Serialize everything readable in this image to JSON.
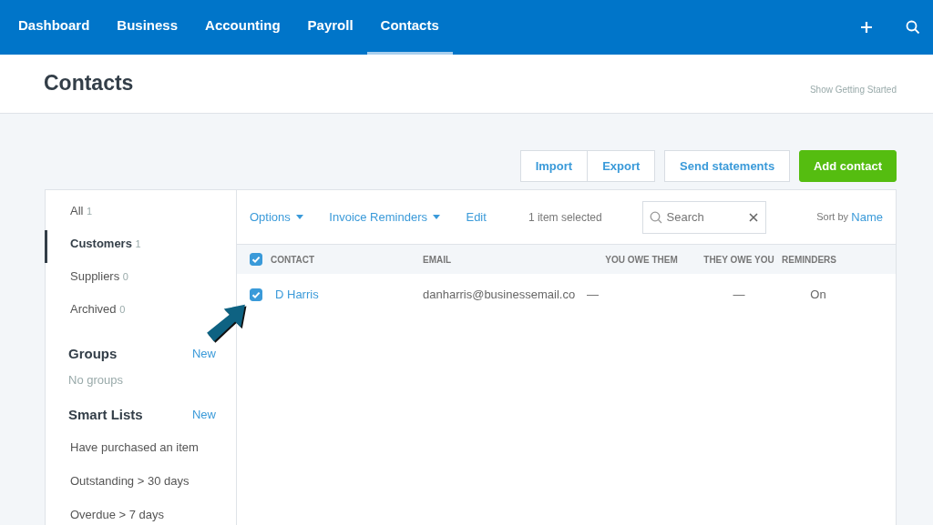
{
  "nav": {
    "tabs": [
      {
        "label": "Dashboard",
        "selected": false
      },
      {
        "label": "Business",
        "selected": false
      },
      {
        "label": "Accounting",
        "selected": false
      },
      {
        "label": "Payroll",
        "selected": false
      },
      {
        "label": "Contacts",
        "selected": true
      }
    ]
  },
  "header": {
    "title": "Contacts",
    "link": "Show Getting Started"
  },
  "actions": {
    "group": [
      "Import",
      "Export"
    ],
    "secondary": "Send statements",
    "primary": "Add contact"
  },
  "sidebar": {
    "items": [
      {
        "label": "All",
        "count": "1",
        "selected": false
      },
      {
        "label": "Customers",
        "count": "1",
        "selected": true
      },
      {
        "label": "Suppliers",
        "count": "0",
        "selected": false
      },
      {
        "label": "Archived",
        "count": "0",
        "selected": false
      }
    ],
    "groups": {
      "title": "Groups",
      "new": "New",
      "empty": "No groups"
    },
    "smart_lists": {
      "title": "Smart Lists",
      "new": "New",
      "items": [
        "Have purchased an item",
        "Outstanding > 30 days",
        "Overdue > 7 days"
      ]
    }
  },
  "toolbar": {
    "options": "Options",
    "reminders": "Invoice Reminders",
    "edit": "Edit",
    "selection": "1 item selected",
    "search": {
      "placeholder": "Search"
    },
    "sort_label": "Sort by",
    "sort_value": "Name"
  },
  "table": {
    "all_checked": true,
    "columns": [
      "CONTACT",
      "EMAIL",
      "YOU OWE THEM",
      "THEY OWE YOU",
      "REMINDERS"
    ],
    "rows": [
      {
        "checked": true,
        "name": "D Harris",
        "email": "danharris@businessemail.co",
        "you_owe": "—",
        "they_owe": "—",
        "reminders": "On"
      }
    ]
  }
}
